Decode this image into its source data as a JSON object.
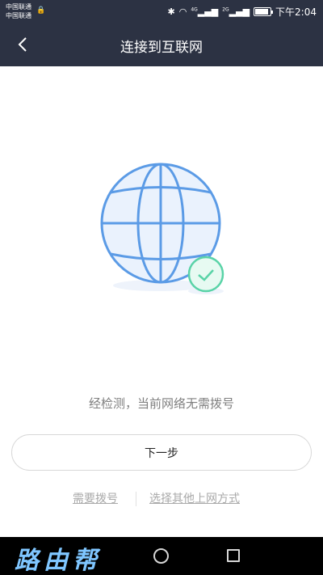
{
  "status_bar": {
    "carrier_1": "中国联通",
    "carrier_2": "中国联通",
    "time": "下午2:04",
    "network_1": "4G",
    "network_2": "2G",
    "battery_level": 0.9
  },
  "header": {
    "title": "连接到互联网",
    "back_icon": "chevron-left-icon"
  },
  "illustration": {
    "globe_icon": "globe-icon",
    "check_icon": "check-circle-icon",
    "globe_color": "#5b9be6",
    "check_color": "#59d3a7"
  },
  "main": {
    "message": "经检测，当前网络无需拨号",
    "next_button": "下一步",
    "link_dial": "需要拨号",
    "link_other": "选择其他上网方式"
  },
  "system_nav": {
    "watermark": "路由帮"
  },
  "colors": {
    "header_bg": "#2c3243",
    "accent_green": "#59d3a7"
  }
}
